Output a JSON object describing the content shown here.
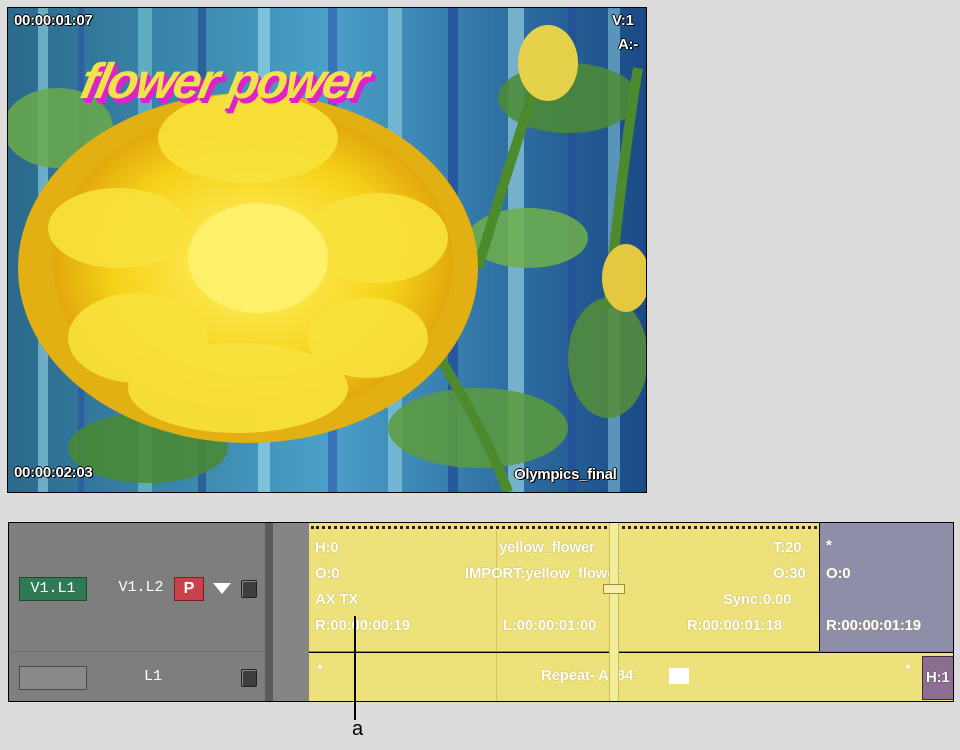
{
  "viewer": {
    "timecode_top_left": "00:00:01:07",
    "timecode_bottom_left": "00:00:02:03",
    "track_v": "V:1",
    "track_a": "A:-",
    "sequence_name": "Olympics_final",
    "title_overlay": "flower power"
  },
  "timeline": {
    "track_header": {
      "video_layer1": "V1.L1",
      "video_layer2": "V1.L2",
      "audio_layer": "L1",
      "primary_button": "P"
    },
    "main_clip": {
      "head": "H:0",
      "offset": "O:0",
      "fx": "AX TX",
      "record_in": "R:00:00:00:19",
      "name": "yellow_flower",
      "import": "IMPORT:yellow_flower",
      "length": "L:00:00:01:00",
      "tail": "T:20",
      "tail_offset": "O:30",
      "sync": "Sync:0.00",
      "record_out": "R:00:00:01:18"
    },
    "next_clip": {
      "marker": "*",
      "offset": "O:0",
      "record_in": "R:00:00:01:19"
    },
    "row2": {
      "marker_left": "*",
      "repeat_label": "Repeat- A584",
      "marker_right": "*",
      "h_tab": "H:1"
    }
  },
  "callout": {
    "label": "a"
  },
  "colors": {
    "clip_yellow": "#ede17b",
    "clip_purple": "#8f8ea8",
    "track_green": "#2f7a55",
    "p_button_red": "#c8424b",
    "title_magenta": "#e020c8"
  }
}
